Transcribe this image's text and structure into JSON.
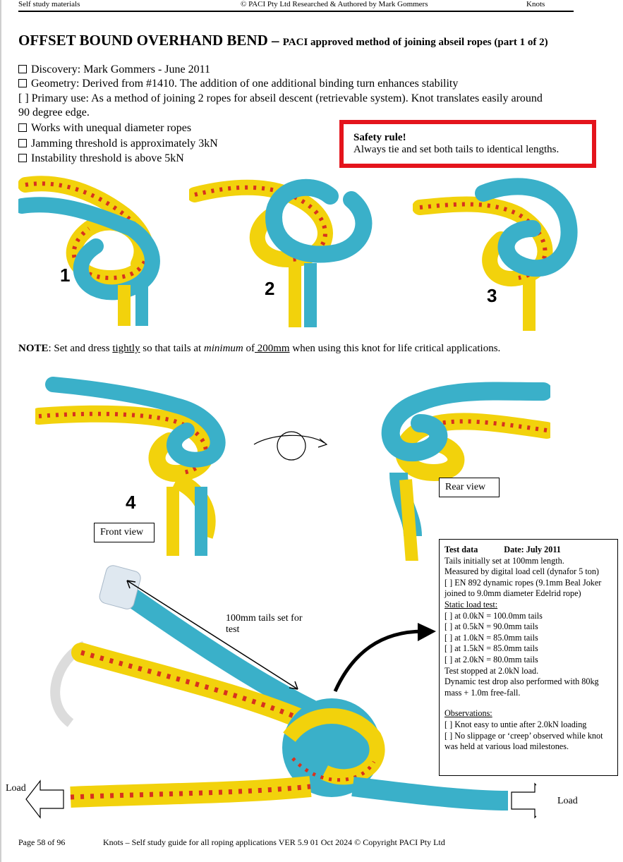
{
  "header": {
    "left": "Self study materials",
    "center": "©  PACI Pty Ltd    Researched & Authored by Mark Gommers",
    "right": "Knots"
  },
  "title": {
    "main": "OFFSET BOUND OVERHAND BEND – ",
    "sub": "PACI approved method of joining abseil ropes (part 1 of 2)"
  },
  "bullets": {
    "discovery": "Discovery: Mark Gommers - June 2011",
    "geometry": "Geometry: Derived from #1410. The addition of one additional binding turn enhances stability",
    "primary_use_1": "[ ] Primary use: As a method of joining 2 ropes for abseil descent (retrievable system). Knot translates easily around",
    "primary_use_2": "90 degree edge.",
    "unequal": "Works with unequal diameter ropes",
    "jamming": "Jamming threshold is approximately 3kN",
    "instability": "Instability threshold is above 5kN"
  },
  "safety": {
    "heading": "Safety rule!",
    "text": "Always tie and set both tails to identical lengths."
  },
  "steps": [
    "1",
    "2",
    "3",
    "4"
  ],
  "note": {
    "label": "NOTE",
    "t1": ": Set and dress ",
    "tightly": "tightly",
    "t2": " so that tails at ",
    "minimum": "minimum",
    "t3": " of",
    "mm": " 200mm",
    "t4": " when using this knot for life critical applications."
  },
  "views": {
    "front": "Front view",
    "rear": "Rear view"
  },
  "annot": {
    "tails": "100mm tails set for test",
    "load_left": "Load",
    "load_right": "Load"
  },
  "test": {
    "title": "Test data",
    "date": "Date: July 2011",
    "lines1": [
      "Tails initially set at 100mm length.",
      "Measured by digital load cell (dynafor 5 ton)",
      " [ ] EN 892 dynamic ropes (9.1mm Beal Joker joined to 9.0mm diameter Edelrid rope)"
    ],
    "static_heading": "Static load test:",
    "static_lines": [
      "[ ] at 0.0kN = 100.0mm tails",
      "[ ] at 0.5kN = 90.0mm tails",
      "[ ] at 1.0kN = 85.0mm tails",
      "[ ] at 1.5kN = 85.0mm tails",
      "[ ] at 2.0kN = 80.0mm tails",
      "Test stopped at 2.0kN load.",
      "Dynamic test drop also performed with 80kg mass + 1.0m free-fall."
    ],
    "obs_heading": "Observations:",
    "obs_lines": [
      "[ ] Knot easy to untie after 2.0kN loading",
      "[ ] No slippage or ‘creep’ observed while knot was held at various load milestones."
    ]
  },
  "footer": {
    "page": "Page 58 of 96",
    "text": "Knots – Self study guide for all roping applications  VER 5.9 01 Oct 2024 © Copyright PACI Pty Ltd"
  },
  "colors": {
    "safety_border": "#e4141c",
    "rope_blue": "#3ab0c9",
    "rope_yellow": "#f2d20c",
    "rope_red": "#d8321e"
  }
}
